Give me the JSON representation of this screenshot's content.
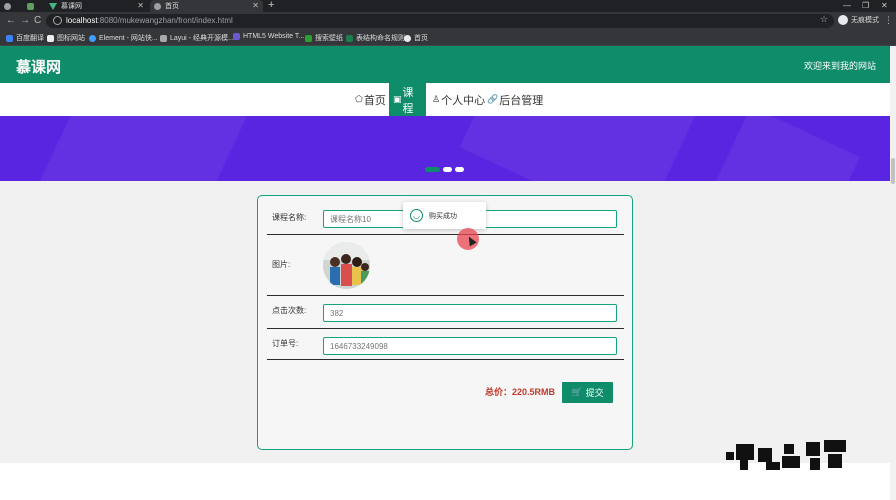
{
  "browser": {
    "tabs": [
      {
        "label": ""
      },
      {
        "label": "慕课网"
      },
      {
        "label": "首页"
      }
    ],
    "new_tab": "+",
    "window_controls": {
      "minimize": "—",
      "restore": "❐",
      "close": "✕"
    },
    "nav": {
      "back": "←",
      "forward": "→",
      "reload": "C"
    },
    "url_host": "localhost",
    "url_rest": ":8080/mukewangzhan/front/index.html",
    "star": "☆",
    "profile_label": "无痕模式",
    "menu": "⋮",
    "bookmarks": [
      {
        "label": "百度翻译"
      },
      {
        "label": "图标网站"
      },
      {
        "label": "Element - 网站快..."
      },
      {
        "label": "Layui - 经典开源模..."
      },
      {
        "label": "HTML5 Website T..."
      },
      {
        "label": "搜索壁纸"
      },
      {
        "label": "表结构命名规则"
      },
      {
        "label": "首页"
      }
    ]
  },
  "site": {
    "logo": "慕课网",
    "welcome": "欢迎来到我的网站",
    "nav": [
      {
        "icon": "⬠",
        "label": "首页",
        "active": false
      },
      {
        "icon": "▣",
        "label": "课程",
        "active": true
      },
      {
        "icon": "♙",
        "label": "个人中心",
        "active": false
      },
      {
        "icon": "🔗",
        "label": "后台管理",
        "active": false
      }
    ]
  },
  "form": {
    "course_name_label": "课程名称:",
    "course_name_value": "课程名称10",
    "image_label": "图片:",
    "clicks_label": "点击次数:",
    "clicks_value": "382",
    "order_label": "订单号:",
    "order_value": "1646733249098",
    "total": "总价：220.5RMB",
    "submit_label": "提交"
  },
  "toast": {
    "message": "购买成功"
  },
  "colors": {
    "brand_green": "#0f8c6a",
    "banner_purple": "#5a25e0",
    "price_red": "#c0392b"
  }
}
